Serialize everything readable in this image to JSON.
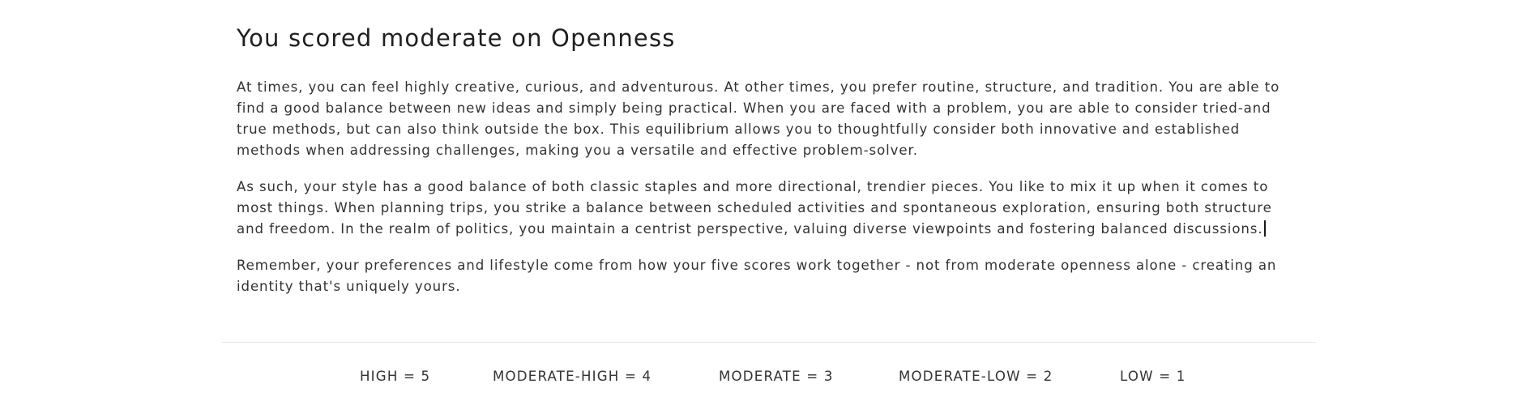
{
  "heading": "You scored moderate on Openness",
  "paragraphs": [
    "At times, you can feel highly creative, curious, and adventurous. At other times, you prefer routine, structure, and tradition. You are able to find a good balance between new ideas and simply being practical. When you are faced with a problem, you are able to consider tried-and true methods, but can also think outside the box. This equilibrium allows you to thoughtfully consider both innovative and established methods when addressing challenges, making you a versatile and effective problem-solver.",
    "As such, your style has a good balance of both classic staples and more directional, trendier pieces. You like to mix it up when it comes to most things. When planning trips, you strike a balance between scheduled activities and spontaneous exploration, ensuring both structure and freedom. In the realm of politics, you maintain a centrist perspective, valuing diverse viewpoints and fostering balanced discussions.",
    "Remember, your preferences and lifestyle come from how your five scores work together - not from moderate openness alone - creating an identity that's uniquely yours."
  ],
  "score_legend": [
    "HIGH = 5",
    "MODERATE-HIGH = 4",
    "MODERATE = 3",
    "MODERATE-LOW = 2",
    "LOW = 1"
  ]
}
